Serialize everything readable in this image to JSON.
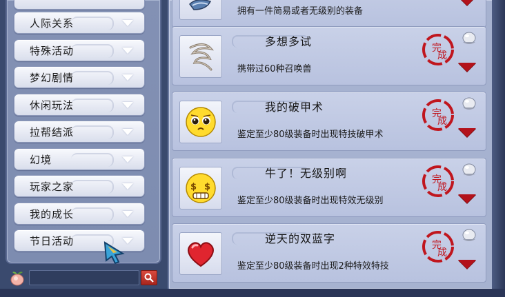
{
  "categories": [
    {
      "label": "人际关系"
    },
    {
      "label": "特殊活动"
    },
    {
      "label": "梦幻剧情"
    },
    {
      "label": "休闲玩法"
    },
    {
      "label": "拉帮结派"
    },
    {
      "label": "幻境"
    },
    {
      "label": "玩家之家"
    },
    {
      "label": "我的成长"
    },
    {
      "label": "节日活动"
    }
  ],
  "search": {
    "value": "",
    "placeholder": ""
  },
  "achievements": [
    {
      "title": "",
      "desc": "拥有一件简易或者无级别的装备",
      "icon": "armor-icon",
      "status": "完成"
    },
    {
      "title": "多想多试",
      "desc": "携带过60种召唤兽",
      "icon": "rope-icon",
      "status": "完成"
    },
    {
      "title": "我的破甲术",
      "desc": "鉴定至少80级装备时出现特技破甲术",
      "icon": "pleading-face-icon",
      "status": "完成"
    },
    {
      "title": "牛了！无级别啊",
      "desc": "鉴定至少80级装备时出现特效无级别",
      "icon": "money-eyes-face-icon",
      "status": "完成"
    },
    {
      "title": "逆天的双蓝字",
      "desc": "鉴定至少80级装备时出现2种特效特技",
      "icon": "heart-icon",
      "status": "完成"
    }
  ],
  "colors": {
    "seal_red": "#c0161e",
    "panel_blue": "#a6b2d0",
    "button_light": "#eef1f8"
  }
}
